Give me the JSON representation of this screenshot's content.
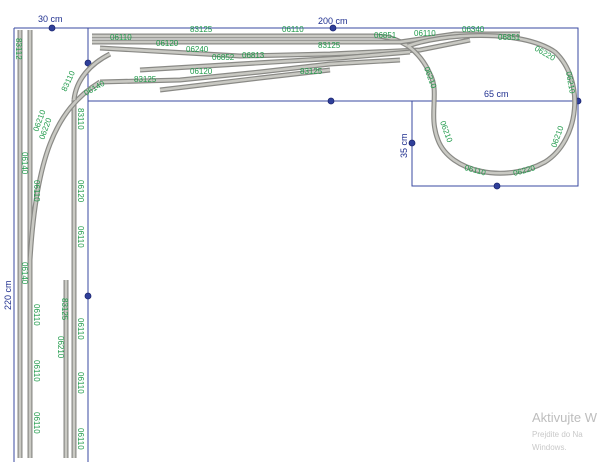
{
  "dimensions": {
    "top_left_width": "30 cm",
    "total_width": "200 cm",
    "total_height": "220 cm",
    "loop_width": "65 cm",
    "loop_height": "35 cm"
  },
  "part_numbers": [
    "83125",
    "06110",
    "06340",
    "06851",
    "06220",
    "06210",
    "83125",
    "06120",
    "06240",
    "06852",
    "06813",
    "06110",
    "83125",
    "06120",
    "06851",
    "06210",
    "06210",
    "06220",
    "06110",
    "83110",
    "83125",
    "06210",
    "06140",
    "06110",
    "83110",
    "06120",
    "06110",
    "06110",
    "83125",
    "06110",
    "06110",
    "06140",
    "06110",
    "06210",
    "06220",
    "06140",
    "83112",
    "06110",
    "06210",
    "06110",
    "06110"
  ],
  "watermark": {
    "line1": "Aktivujte W",
    "line2": "Prejdite do Na",
    "line3": "Windows."
  }
}
